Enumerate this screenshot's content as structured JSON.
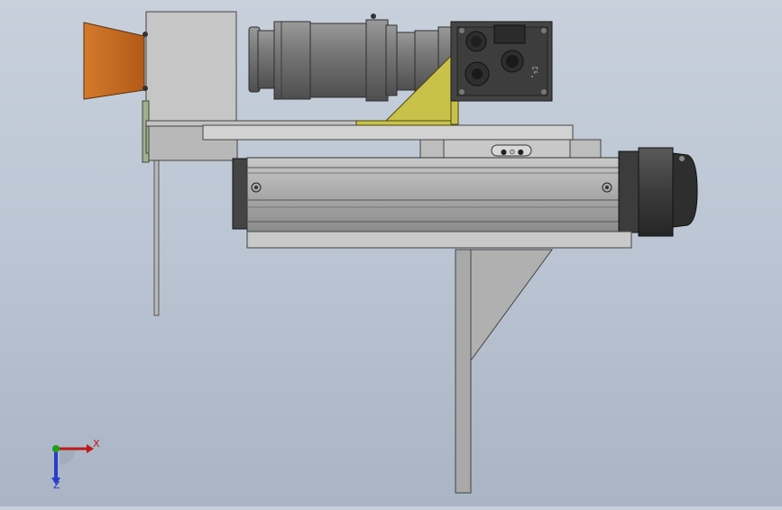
{
  "viewport": {
    "background_top": "#c8d0dc",
    "background_bottom": "#a9b4c4"
  },
  "model": {
    "colors": {
      "nozzle": "#c0651f",
      "bracket_yellow": "#c9c24a",
      "bracket_green": "#9fb18a",
      "metal_light": "#c4c4c4",
      "metal_mid": "#a8a8a8",
      "metal_dark": "#3f3f3f",
      "lens_gray": "#6f6f6f"
    },
    "camera_connector_label": "ﾟｯｺ",
    "carriage_marks": "● ⊙ ●"
  },
  "triad": {
    "x_label": "X",
    "z_label": "Z",
    "x_color": "#c01818",
    "y_color": "#1aa01a",
    "z_color": "#2a3cc8"
  }
}
